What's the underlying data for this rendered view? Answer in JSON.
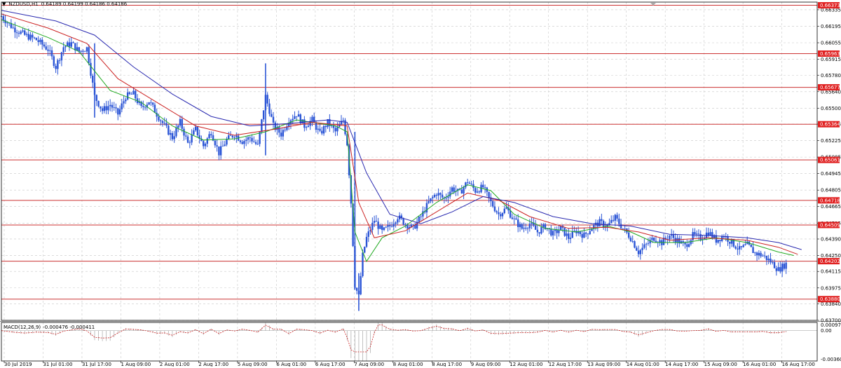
{
  "header": {
    "symbol": "NZDUSD,H1",
    "ohlc": "0.64189 0.64199 0.64186 0.64186"
  },
  "macd_header": {
    "name": "MACD(12,26,9)",
    "values": "-0.000476 -0.000411"
  },
  "colors": {
    "candle": "#2b55d6",
    "level_line": "#cc3333",
    "ma_fast": "#22aa22",
    "ma_mid": "#cc2222",
    "ma_slow": "#2a2ab0",
    "grid": "#c8c8c8",
    "macd_hist": "#b0b0b0",
    "macd_signal": "#cc2222",
    "marker_bg": "#e02020"
  },
  "chart_data": {
    "type": "candlestick",
    "symbol": "NZDUSD",
    "timeframe": "H1",
    "ylim": [
      0.637,
      0.664
    ],
    "y_ticks": [
      "0.66335",
      "0.66195",
      "0.66055",
      "0.65915",
      "0.65780",
      "0.65640",
      "0.65500",
      "0.65365",
      "0.65225",
      "0.65085",
      "0.64945",
      "0.64805",
      "0.64665",
      "0.64525",
      "0.64390",
      "0.64250",
      "0.64115",
      "0.63975",
      "0.63840",
      "0.63700"
    ],
    "x_ticks": [
      "30 Jul 2019",
      "31 Jul 01:00",
      "31 Jul 17:00",
      "1 Aug 09:00",
      "2 Aug 01:00",
      "2 Aug 17:00",
      "5 Aug 09:00",
      "6 Aug 01:00",
      "6 Aug 17:00",
      "7 Aug 09:00",
      "8 Aug 01:00",
      "8 Aug 17:00",
      "9 Aug 09:00",
      "12 Aug 01:00",
      "12 Aug 17:00",
      "13 Aug 09:00",
      "14 Aug 01:00",
      "14 Aug 17:00",
      "15 Aug 09:00",
      "16 Aug 01:00",
      "16 Aug 17:00"
    ],
    "horizontal_levels": [
      "0.66373",
      "0.65963",
      "0.65677",
      "0.65364",
      "0.65061",
      "0.64718",
      "0.64509",
      "0.64202",
      "0.63880"
    ],
    "price_path": [
      [
        0,
        0.6628
      ],
      [
        3,
        0.6618
      ],
      [
        6,
        0.6612
      ],
      [
        9,
        0.6608
      ],
      [
        12,
        0.66
      ],
      [
        14,
        0.6585
      ],
      [
        16,
        0.6602
      ],
      [
        18,
        0.6605
      ],
      [
        20,
        0.6598
      ],
      [
        22,
        0.6601
      ],
      [
        24,
        0.656
      ],
      [
        26,
        0.6548
      ],
      [
        28,
        0.6553
      ],
      [
        30,
        0.6545
      ],
      [
        32,
        0.656
      ],
      [
        34,
        0.6562
      ],
      [
        36,
        0.655
      ],
      [
        38,
        0.6556
      ],
      [
        40,
        0.6545
      ],
      [
        42,
        0.6535
      ],
      [
        44,
        0.6525
      ],
      [
        46,
        0.6538
      ],
      [
        48,
        0.652
      ],
      [
        50,
        0.6532
      ],
      [
        52,
        0.6518
      ],
      [
        54,
        0.653
      ],
      [
        56,
        0.6512
      ],
      [
        58,
        0.6523
      ],
      [
        60,
        0.6528
      ],
      [
        62,
        0.6522
      ],
      [
        64,
        0.6525
      ],
      [
        66,
        0.6518
      ],
      [
        68,
        0.656
      ],
      [
        69,
        0.6548
      ],
      [
        70,
        0.6535
      ],
      [
        72,
        0.6528
      ],
      [
        74,
        0.654
      ],
      [
        76,
        0.6545
      ],
      [
        78,
        0.6535
      ],
      [
        80,
        0.654
      ],
      [
        82,
        0.6528
      ],
      [
        84,
        0.6538
      ],
      [
        86,
        0.653
      ],
      [
        88,
        0.654
      ],
      [
        89,
        0.652
      ],
      [
        90,
        0.647
      ],
      [
        91,
        0.64
      ],
      [
        92,
        0.639
      ],
      [
        93,
        0.6425
      ],
      [
        94,
        0.644
      ],
      [
        96,
        0.6455
      ],
      [
        98,
        0.6445
      ],
      [
        100,
        0.645
      ],
      [
        102,
        0.6458
      ],
      [
        104,
        0.6452
      ],
      [
        106,
        0.6448
      ],
      [
        108,
        0.6458
      ],
      [
        110,
        0.647
      ],
      [
        112,
        0.6478
      ],
      [
        114,
        0.6473
      ],
      [
        116,
        0.6482
      ],
      [
        118,
        0.6478
      ],
      [
        120,
        0.6488
      ],
      [
        122,
        0.648
      ],
      [
        124,
        0.6483
      ],
      [
        126,
        0.647
      ],
      [
        128,
        0.646
      ],
      [
        130,
        0.6465
      ],
      [
        132,
        0.6455
      ],
      [
        134,
        0.6448
      ],
      [
        136,
        0.6452
      ],
      [
        138,
        0.6445
      ],
      [
        140,
        0.645
      ],
      [
        142,
        0.6443
      ],
      [
        144,
        0.6448
      ],
      [
        146,
        0.644
      ],
      [
        148,
        0.6446
      ],
      [
        150,
        0.6442
      ],
      [
        152,
        0.6449
      ],
      [
        154,
        0.6453
      ],
      [
        156,
        0.645
      ],
      [
        158,
        0.6457
      ],
      [
        160,
        0.6448
      ],
      [
        162,
        0.644
      ],
      [
        164,
        0.6428
      ],
      [
        166,
        0.6434
      ],
      [
        168,
        0.644
      ],
      [
        170,
        0.6436
      ],
      [
        172,
        0.6442
      ],
      [
        174,
        0.6438
      ],
      [
        176,
        0.6433
      ],
      [
        178,
        0.6442
      ],
      [
        180,
        0.644
      ],
      [
        182,
        0.6445
      ],
      [
        184,
        0.6438
      ],
      [
        186,
        0.6442
      ],
      [
        188,
        0.6436
      ],
      [
        190,
        0.643
      ],
      [
        192,
        0.6434
      ],
      [
        194,
        0.6427
      ],
      [
        196,
        0.6425
      ],
      [
        198,
        0.642
      ],
      [
        200,
        0.6413
      ],
      [
        202,
        0.6418
      ]
    ],
    "ma_fast_path": [
      [
        0,
        0.6625
      ],
      [
        12,
        0.661
      ],
      [
        20,
        0.6598
      ],
      [
        28,
        0.6565
      ],
      [
        36,
        0.6555
      ],
      [
        44,
        0.6535
      ],
      [
        52,
        0.6523
      ],
      [
        60,
        0.6524
      ],
      [
        68,
        0.653
      ],
      [
        76,
        0.654
      ],
      [
        86,
        0.6535
      ],
      [
        89,
        0.653
      ],
      [
        91,
        0.6445
      ],
      [
        94,
        0.642
      ],
      [
        98,
        0.644
      ],
      [
        104,
        0.645
      ],
      [
        112,
        0.647
      ],
      [
        120,
        0.6485
      ],
      [
        126,
        0.648
      ],
      [
        132,
        0.646
      ],
      [
        140,
        0.6448
      ],
      [
        148,
        0.6445
      ],
      [
        156,
        0.645
      ],
      [
        162,
        0.6445
      ],
      [
        168,
        0.6436
      ],
      [
        176,
        0.6436
      ],
      [
        184,
        0.644
      ],
      [
        192,
        0.6436
      ],
      [
        200,
        0.6428
      ],
      [
        204,
        0.6425
      ]
    ],
    "ma_mid_path": [
      [
        0,
        0.663
      ],
      [
        12,
        0.6618
      ],
      [
        22,
        0.6605
      ],
      [
        30,
        0.6575
      ],
      [
        40,
        0.6555
      ],
      [
        50,
        0.6535
      ],
      [
        60,
        0.6527
      ],
      [
        70,
        0.6532
      ],
      [
        80,
        0.6538
      ],
      [
        89,
        0.6535
      ],
      [
        92,
        0.647
      ],
      [
        96,
        0.644
      ],
      [
        104,
        0.6446
      ],
      [
        112,
        0.6462
      ],
      [
        120,
        0.6478
      ],
      [
        128,
        0.6472
      ],
      [
        136,
        0.6458
      ],
      [
        146,
        0.6448
      ],
      [
        156,
        0.6449
      ],
      [
        164,
        0.6445
      ],
      [
        172,
        0.6438
      ],
      [
        182,
        0.644
      ],
      [
        192,
        0.6438
      ],
      [
        200,
        0.6432
      ],
      [
        205,
        0.6426
      ]
    ],
    "ma_slow_path": [
      [
        0,
        0.6633
      ],
      [
        14,
        0.6624
      ],
      [
        24,
        0.6612
      ],
      [
        34,
        0.6585
      ],
      [
        44,
        0.6562
      ],
      [
        54,
        0.6543
      ],
      [
        64,
        0.6535
      ],
      [
        74,
        0.6537
      ],
      [
        84,
        0.654
      ],
      [
        89,
        0.6538
      ],
      [
        94,
        0.6495
      ],
      [
        100,
        0.646
      ],
      [
        108,
        0.6452
      ],
      [
        116,
        0.6462
      ],
      [
        124,
        0.6475
      ],
      [
        132,
        0.647
      ],
      [
        142,
        0.6458
      ],
      [
        152,
        0.6452
      ],
      [
        162,
        0.645
      ],
      [
        172,
        0.6443
      ],
      [
        182,
        0.6442
      ],
      [
        192,
        0.644
      ],
      [
        200,
        0.6436
      ],
      [
        206,
        0.643
      ]
    ],
    "macd_ylim": [
      -0.003603,
      0.000978
    ],
    "macd_ticks": [
      "0.000978",
      "0.00",
      "-0.003603"
    ]
  }
}
